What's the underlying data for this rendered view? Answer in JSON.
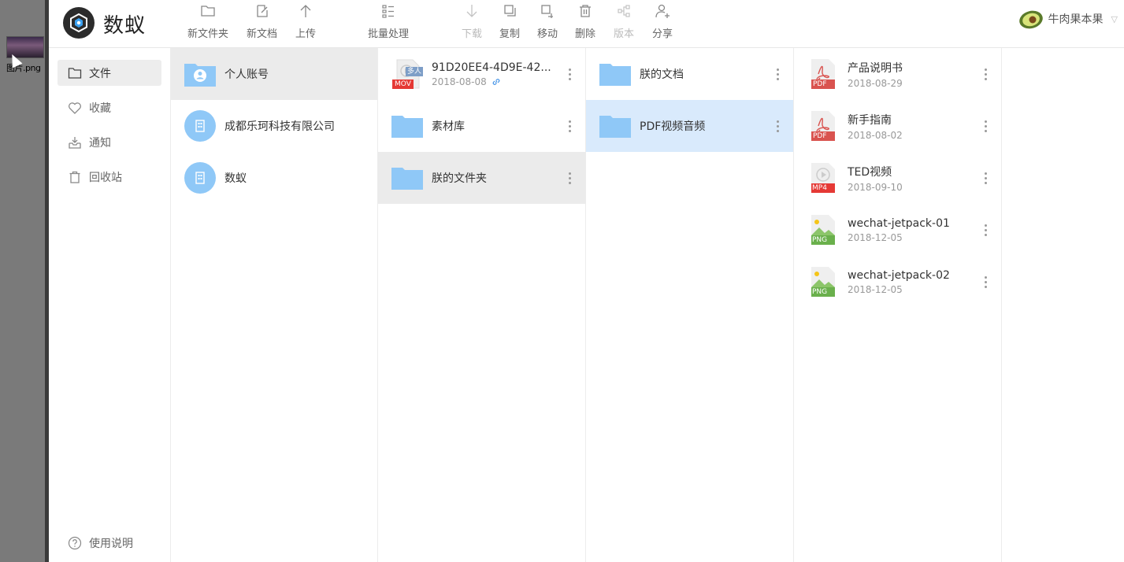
{
  "desktop": {
    "icon_label": "图片.png"
  },
  "app": {
    "brand": "数蚁"
  },
  "toolbar": {
    "new_folder": "新文件夹",
    "new_doc": "新文档",
    "upload": "上传",
    "batch": "批量处理",
    "download": "下载",
    "copy": "复制",
    "move": "移动",
    "delete": "删除",
    "version": "版本",
    "share": "分享"
  },
  "user": {
    "name": "牛肉果本果"
  },
  "sidebar": {
    "items": [
      {
        "label": "文件",
        "icon": "folder-icon",
        "active": true
      },
      {
        "label": "收藏",
        "icon": "heart-icon",
        "active": false
      },
      {
        "label": "通知",
        "icon": "inbox-icon",
        "active": false
      },
      {
        "label": "回收站",
        "icon": "trash-icon",
        "active": false
      }
    ],
    "help": "使用说明"
  },
  "columns": {
    "accounts": [
      {
        "name": "个人账号",
        "icon": "personal-folder-icon"
      },
      {
        "name": "成都乐珂科技有限公司",
        "icon": "organization-icon"
      },
      {
        "name": "数蚁",
        "icon": "organization-icon"
      }
    ],
    "personal": [
      {
        "name": "91D20EE4-4D9E-42...",
        "date": "2018-08-08",
        "type": "MOV",
        "badge": "多人",
        "shared_link": true
      },
      {
        "name": "素材库",
        "type": "folder"
      },
      {
        "name": "朕的文件夹",
        "type": "folder"
      }
    ],
    "my_folder": [
      {
        "name": "朕的文档",
        "type": "folder"
      },
      {
        "name": "PDF视频音频",
        "type": "folder"
      }
    ],
    "pdf_media": [
      {
        "name": "产品说明书",
        "date": "2018-08-29",
        "type": "PDF"
      },
      {
        "name": "新手指南",
        "date": "2018-08-02",
        "type": "PDF"
      },
      {
        "name": "TED视频",
        "date": "2018-09-10",
        "type": "MP4"
      },
      {
        "name": "wechat-jetpack-01",
        "date": "2018-12-05",
        "type": "PNG"
      },
      {
        "name": "wechat-jetpack-02",
        "date": "2018-12-05",
        "type": "PNG"
      }
    ]
  },
  "colors": {
    "folder_blue": "#8fc8f7",
    "selected_gray": "#ebebeb",
    "highlight_blue": "#d9eafc",
    "pdf_red": "#d9534f",
    "mp4_red": "#e53935",
    "png_green": "#6ab04c"
  }
}
